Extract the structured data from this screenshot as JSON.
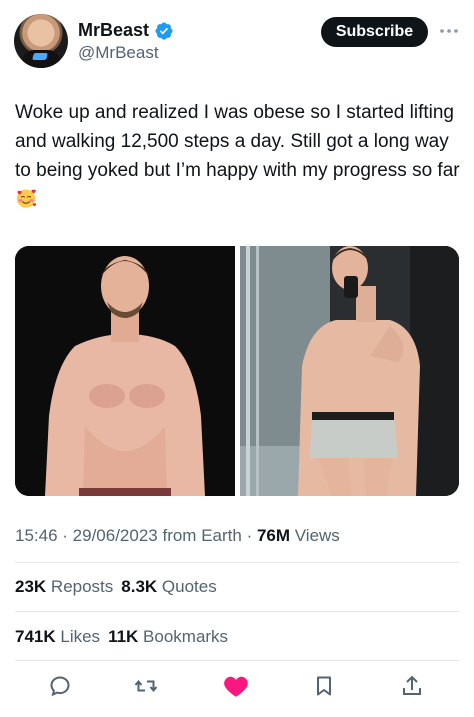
{
  "author": {
    "display_name": "MrBeast",
    "handle": "@MrBeast",
    "verified": true
  },
  "header": {
    "subscribe_label": "Subscribe",
    "more_icon": "more-horizontal-icon"
  },
  "tweet": {
    "text": "Woke up and realized I was obese so I started lifting and walking 12,500 steps a day. Still got a long way to being yoked but I’m happy with my progress so far",
    "emoji": "smiling-face-with-hearts"
  },
  "meta": {
    "time": "15:46",
    "sep1": " · ",
    "date": "29/06/2023",
    "source": " from Earth",
    "sep2": " · ",
    "views_count": "76M",
    "views_label": " Views"
  },
  "stats": {
    "reposts_count": "23K",
    "reposts_label": " Reposts",
    "quotes_count": "8.3K",
    "quotes_label": " Quotes",
    "likes_count": "741K",
    "likes_label": " Likes",
    "bookmarks_count": "11K",
    "bookmarks_label": " Bookmarks"
  },
  "actions": {
    "icons": [
      "reply-icon",
      "repost-icon",
      "like-icon",
      "bookmark-icon",
      "share-icon"
    ],
    "like_color": "#f91880",
    "icon_color": "#536471"
  },
  "colors": {
    "verified_blue": "#1d9bf0",
    "text_primary": "#0f1419",
    "text_secondary": "#536471",
    "button_dark": "#0f1419"
  }
}
